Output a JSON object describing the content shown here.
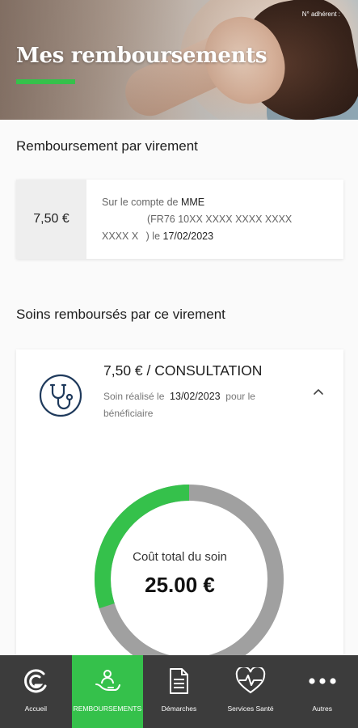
{
  "header": {
    "title": "Mes remboursements",
    "member_label": "N° adhérent :"
  },
  "transfer": {
    "section_title": "Remboursement par virement",
    "amount": "7,50 €",
    "prefix": "Sur le compte de",
    "account_holder": "MME",
    "iban": "(FR76 10XX XXXX XXXX XXXX XXXX X",
    "date_prefix": ") le",
    "date": "17/02/2023"
  },
  "care": {
    "section_title": "Soins remboursés par ce virement",
    "title": "7,50 € / CONSULTATION",
    "performed_label": "Soin réalisé le",
    "performed_date": "13/02/2023",
    "beneficiary_label": "pour le bénéficiaire",
    "icon": "stethoscope-icon"
  },
  "donut": {
    "label": "Coût total du soin",
    "value": "25.00 €",
    "reimbursed_fraction": 0.3,
    "colors": {
      "reimbursed": "#35c14b",
      "remaining": "#a0a0a0"
    }
  },
  "nav": {
    "items": [
      {
        "label": "Accueil",
        "icon": "home-logo-icon"
      },
      {
        "label": "REMBOURSEMENTS",
        "icon": "hand-person-icon"
      },
      {
        "label": "Démarches",
        "icon": "document-icon"
      },
      {
        "label": "Services Santé",
        "icon": "heartbeat-icon"
      },
      {
        "label": "Autres",
        "icon": "more-dots-icon"
      }
    ],
    "active_index": 1,
    "colors": {
      "bar": "#3c3c3c",
      "active": "#35c14b"
    }
  }
}
